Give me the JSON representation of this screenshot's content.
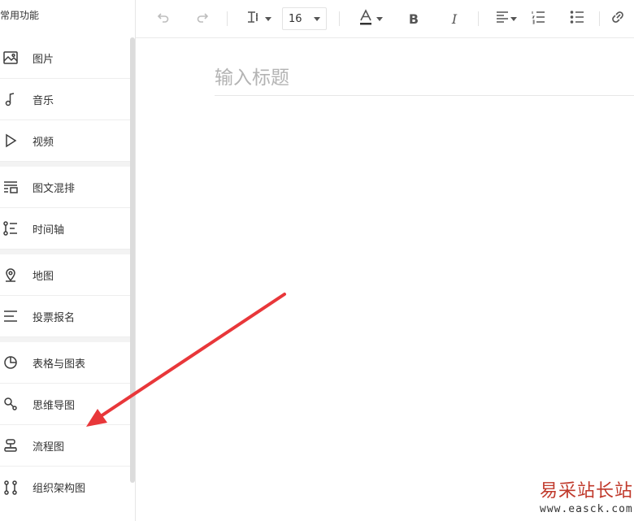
{
  "sidebar": {
    "title": "常用功能",
    "groups": [
      [
        {
          "label": "图片",
          "icon": "image-icon"
        },
        {
          "label": "音乐",
          "icon": "music-note-icon"
        },
        {
          "label": "视频",
          "icon": "play-icon"
        }
      ],
      [
        {
          "label": "图文混排",
          "icon": "text-image-layout-icon"
        },
        {
          "label": "时间轴",
          "icon": "timeline-icon"
        }
      ],
      [
        {
          "label": "地图",
          "icon": "map-pin-icon"
        },
        {
          "label": "投票报名",
          "icon": "list-lines-icon"
        }
      ],
      [
        {
          "label": "表格与图表",
          "icon": "pie-chart-icon"
        },
        {
          "label": "思维导图",
          "icon": "mind-map-icon"
        },
        {
          "label": "流程图",
          "icon": "flowchart-icon"
        },
        {
          "label": "组织架构图",
          "icon": "org-chart-icon"
        }
      ]
    ]
  },
  "toolbar": {
    "undo": "undo-icon",
    "redo": "redo-icon",
    "text_style": "text-style-icon",
    "font_size": "16",
    "font_color": "font-color-icon",
    "bold": "B",
    "italic": "I",
    "align": "align-left-icon",
    "ordered_list": "ordered-list-icon",
    "unordered_list": "unordered-list-icon",
    "link": "link-icon"
  },
  "editor": {
    "title_placeholder": "输入标题"
  },
  "watermark": {
    "title": "易采站长站",
    "url": "www.easck.com"
  },
  "colors": {
    "arrow": "#e8373a",
    "watermark": "#c0392b"
  }
}
